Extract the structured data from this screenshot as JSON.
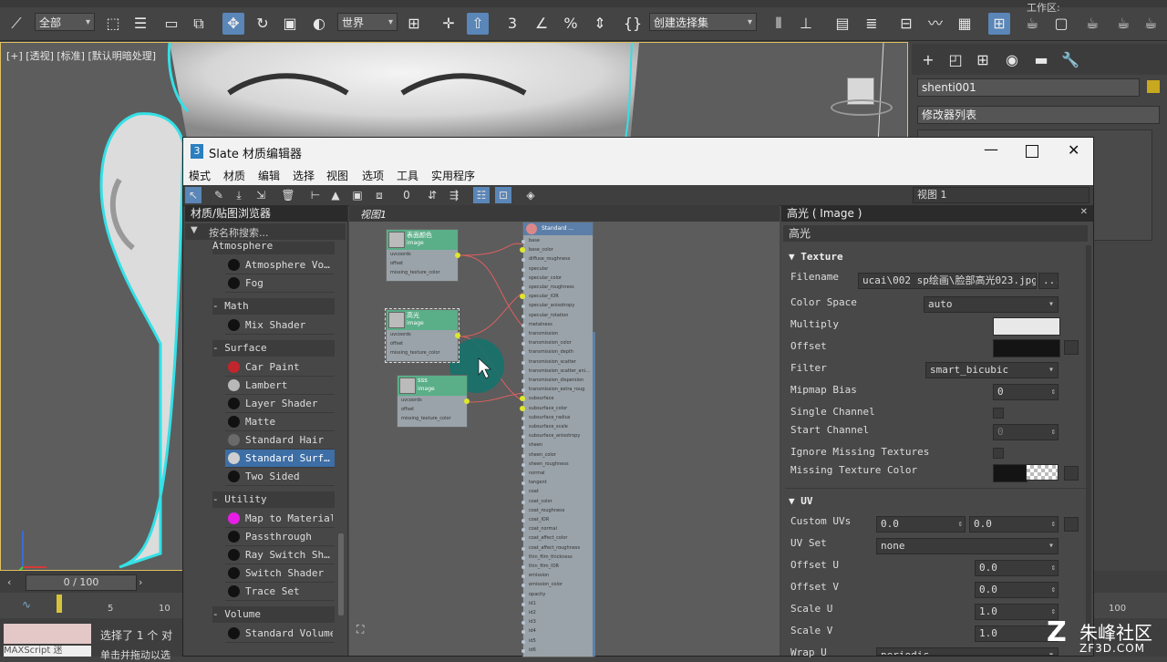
{
  "app": {
    "toolbar": {
      "selection_filter": "全部",
      "coord_system": "世界",
      "selection_set": "创建选择集",
      "workspace_prefix": "工作区:"
    },
    "viewport_label": "[+] [透视] [标准] [默认明暗处理]",
    "command_panel": {
      "object_name": "shenti001",
      "modifier_list": "修改器列表"
    },
    "timeline": {
      "frame": "0 / 100",
      "ticks": [
        "5",
        "10",
        "100"
      ]
    },
    "status": {
      "maxscript": "MAXScript 迷",
      "message": "选择了 1 个 对",
      "message2": "单击并拖动以选"
    },
    "watermark": {
      "name": "朱峰社区",
      "url": "ZF3D.COM"
    }
  },
  "slate": {
    "title": "Slate 材质编辑器",
    "menu": [
      "模式",
      "材质",
      "编辑",
      "选择",
      "视图",
      "选项",
      "工具",
      "实用程序"
    ],
    "view_dropdown": "视图 1",
    "browser": {
      "title": "材质/贴图浏览器",
      "search_placeholder": "按名称搜索...",
      "items": [
        {
          "type": "cat",
          "label": "Atmosphere"
        },
        {
          "type": "item",
          "label": "Atmosphere Vo…",
          "swatch": "#111111"
        },
        {
          "type": "item",
          "label": "Fog",
          "swatch": "#111111"
        },
        {
          "type": "cat",
          "label": "- Math"
        },
        {
          "type": "item",
          "label": "Mix Shader",
          "swatch": "#111111"
        },
        {
          "type": "cat",
          "label": "- Surface"
        },
        {
          "type": "item",
          "label": "Car Paint",
          "swatch": "#c0262b"
        },
        {
          "type": "item",
          "label": "Lambert",
          "swatch": "#b8b8b8"
        },
        {
          "type": "item",
          "label": "Layer Shader",
          "swatch": "#111111"
        },
        {
          "type": "item",
          "label": "Matte",
          "swatch": "#111111"
        },
        {
          "type": "item",
          "label": "Standard Hair",
          "swatch": "#6a6a6a"
        },
        {
          "type": "item",
          "label": "Standard Surf…",
          "swatch": "#cfcfcf",
          "selected": true
        },
        {
          "type": "item",
          "label": "Two Sided",
          "swatch": "#111111"
        },
        {
          "type": "cat",
          "label": "- Utility"
        },
        {
          "type": "item",
          "label": "Map to Material",
          "swatch": "#e61ee6"
        },
        {
          "type": "item",
          "label": "Passthrough",
          "swatch": "#111111"
        },
        {
          "type": "item",
          "label": "Ray Switch Sh…",
          "swatch": "#111111"
        },
        {
          "type": "item",
          "label": "Switch Shader",
          "swatch": "#111111"
        },
        {
          "type": "item",
          "label": "Trace Set",
          "swatch": "#111111"
        },
        {
          "type": "cat",
          "label": "- Volume"
        },
        {
          "type": "item",
          "label": "Standard Volume",
          "swatch": "#111111"
        }
      ]
    },
    "view": {
      "tab": "视图1",
      "nodes": [
        {
          "title": "表面颜色",
          "subtitle": "image",
          "ports": [
            "uvcoords",
            "offset",
            "missing_texture_color"
          ]
        },
        {
          "title": "高光",
          "subtitle": "image",
          "ports": [
            "uvcoords",
            "offset",
            "missing_texture_color"
          ]
        },
        {
          "title": "sss",
          "subtitle": "image",
          "ports": [
            "uvcoords",
            "offset",
            "missing_texture_color"
          ]
        }
      ],
      "standard_node": {
        "title": "Standard ...",
        "ports": [
          "base",
          "base_color",
          "diffuse_roughness",
          "specular",
          "specular_color",
          "specular_roughness",
          "specular_IOR",
          "specular_anisotropy",
          "specular_rotation",
          "metalness",
          "transmission",
          "transmission_color",
          "transmission_depth",
          "transmission_scatter",
          "transmission_scatter_ani...",
          "transmission_dispersion",
          "transmission_extra_roug",
          "subsurface",
          "subsurface_color",
          "subsurface_radius",
          "subsurface_scale",
          "subsurface_anisotropy",
          "sheen",
          "sheen_color",
          "sheen_roughness",
          "normal",
          "tangent",
          "coat",
          "coat_color",
          "coat_roughness",
          "coat_IOR",
          "coat_normal",
          "coat_affect_color",
          "coat_affect_roughness",
          "thin_film_thickness",
          "thin_film_IOR",
          "emission",
          "emission_color",
          "opacity",
          "id1",
          "id2",
          "id3",
          "id4",
          "id5",
          "id6"
        ]
      }
    },
    "params": {
      "title": "高光 ( Image )",
      "name": "高光",
      "texture_section": "Texture",
      "filename_label": "Filename",
      "filename": "ucai\\002 sp绘画\\脸部高光023.jpg",
      "browse": "...",
      "color_space_label": "Color Space",
      "color_space": "auto",
      "multiply_label": "Multiply",
      "offset_label": "Offset",
      "filter_label": "Filter",
      "filter": "smart_bicubic",
      "mipmap_label": "Mipmap Bias",
      "mipmap": "0",
      "single_channel_label": "Single Channel",
      "start_channel_label": "Start Channel",
      "start_channel": "0",
      "ignore_missing_label": "Ignore Missing Textures",
      "missing_color_label": "Missing Texture Color",
      "uv_section": "UV",
      "custom_uvs_label": "Custom UVs",
      "custom_u": "0.0",
      "custom_v": "0.0",
      "uv_set_label": "UV Set",
      "uv_set": "none",
      "offset_u_label": "Offset U",
      "offset_u": "0.0",
      "offset_v_label": "Offset V",
      "offset_v": "0.0",
      "scale_u_label": "Scale U",
      "scale_u": "1.0",
      "scale_v_label": "Scale V",
      "scale_v": "1.0",
      "wrap_u_label": "Wrap U",
      "wrap_u": "periodic"
    }
  },
  "colors": {
    "accent": "#5a86b8",
    "node_header": "#5aae88",
    "selection_outline": "#34e0e6",
    "wire": "#e06060",
    "port_dot": "#dfe72a"
  }
}
